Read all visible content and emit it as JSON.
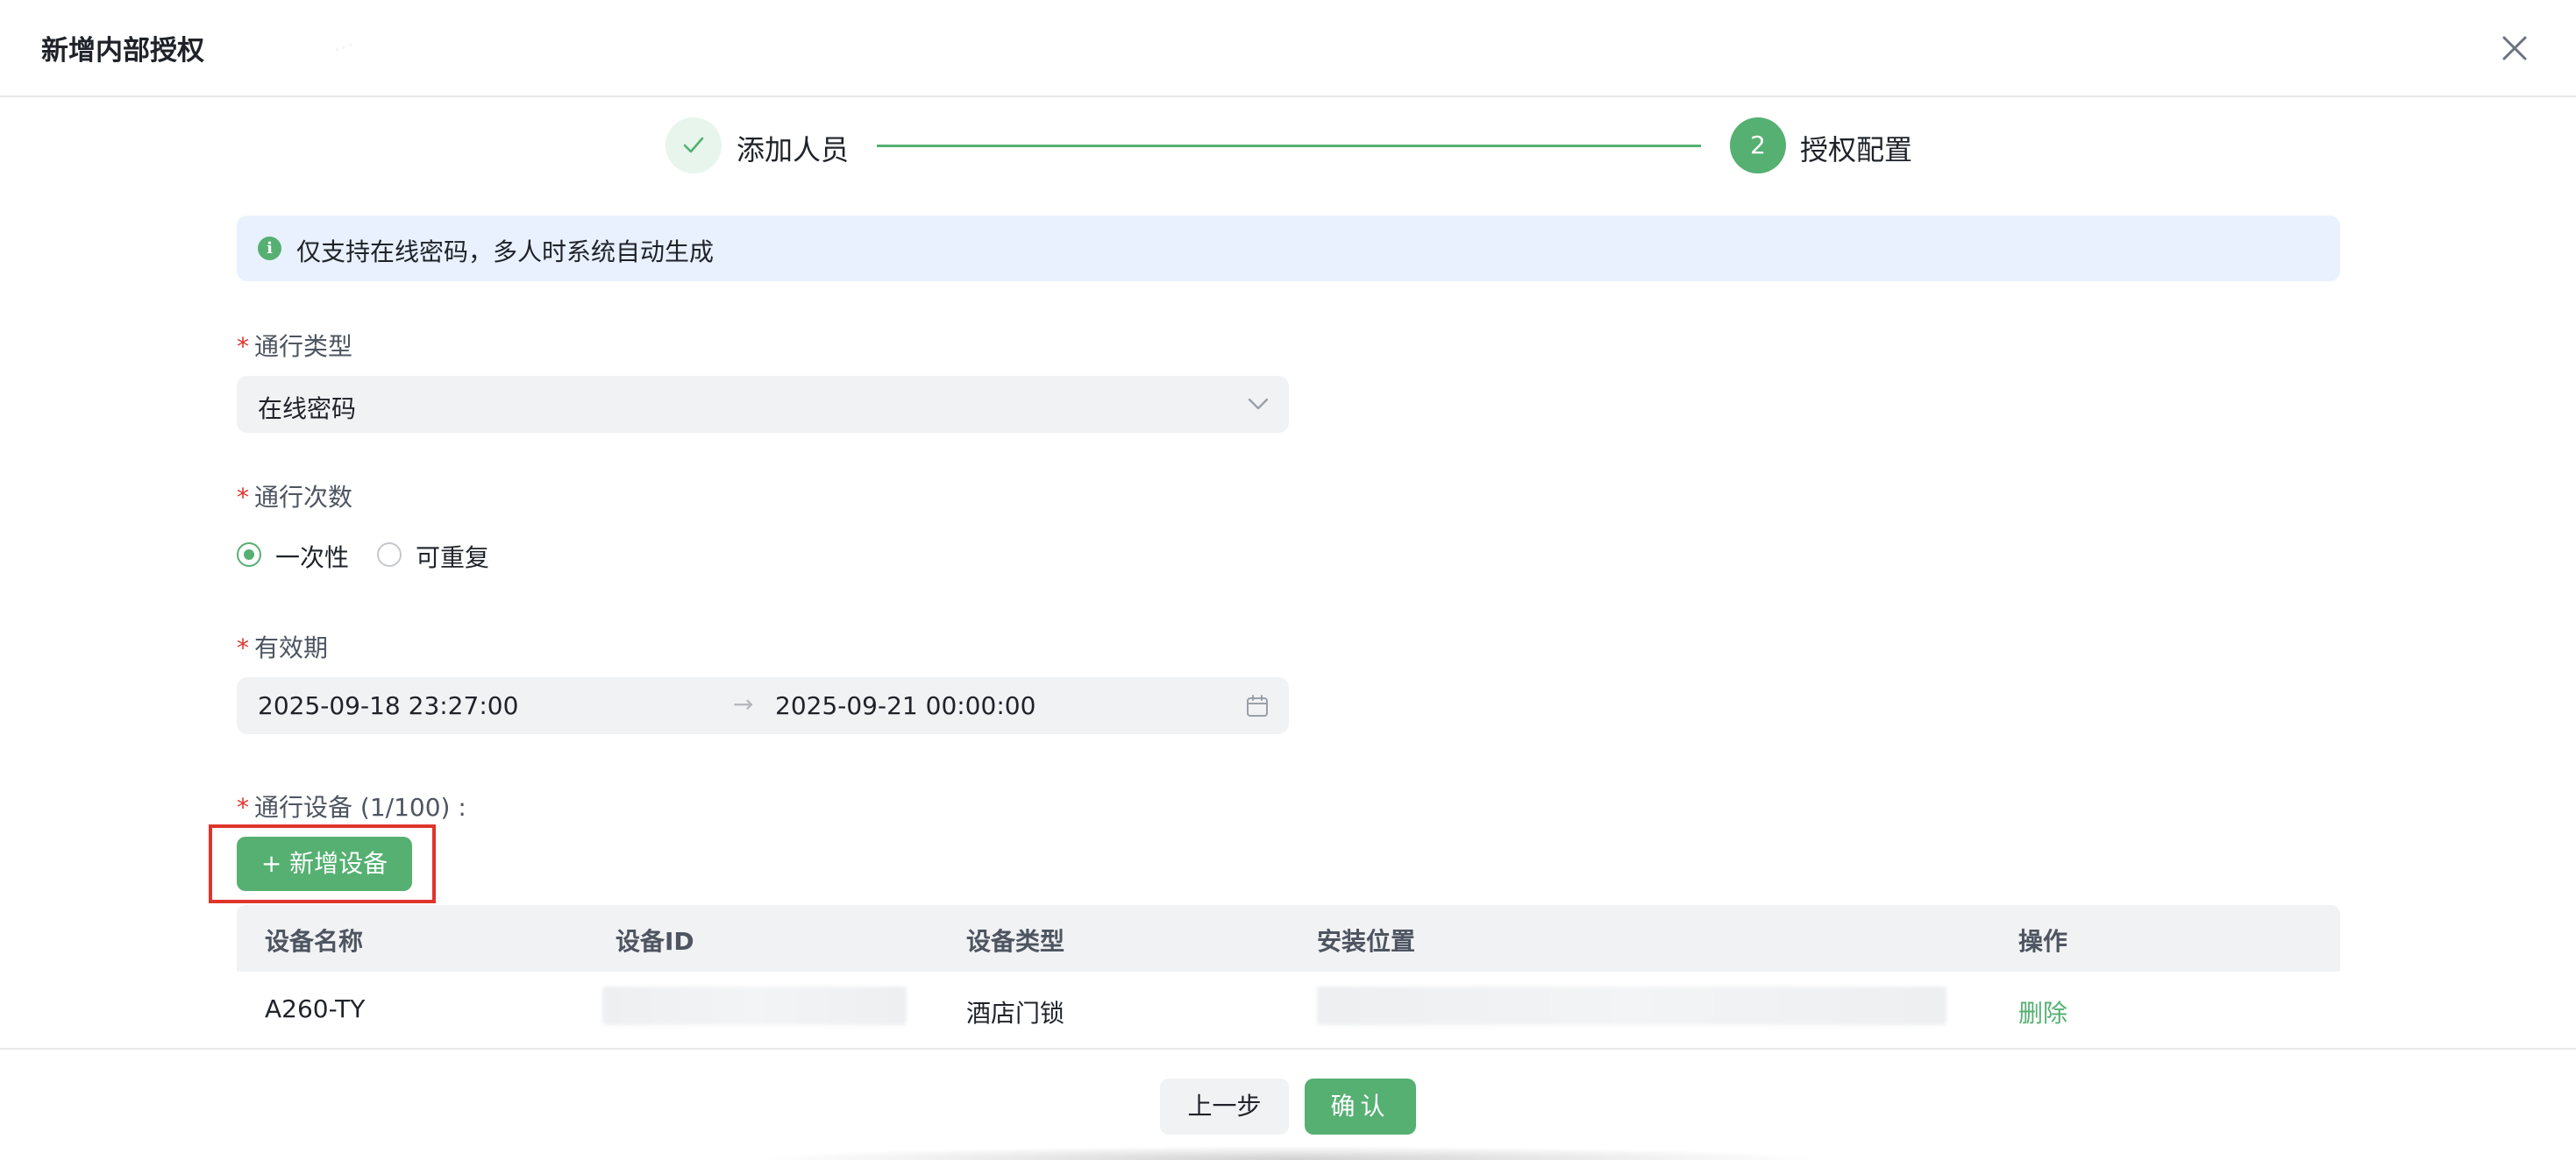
{
  "dialog": {
    "title": "新增内部授权"
  },
  "steps": [
    {
      "label": "添加人员",
      "status": "done"
    },
    {
      "number": "2",
      "label": "授权配置",
      "status": "active"
    }
  ],
  "alert": {
    "text": "仅支持在线密码，多人时系统自动生成"
  },
  "form": {
    "pass_type": {
      "label": "通行类型",
      "value": "在线密码"
    },
    "pass_count": {
      "label": "通行次数",
      "options": [
        "一次性",
        "可重复"
      ],
      "selected": "一次性"
    },
    "validity": {
      "label": "有效期",
      "start": "2025-09-18 23:27:00",
      "separator": "→",
      "end": "2025-09-21 00:00:00"
    },
    "devices": {
      "label": "通行设备 (1/100) :",
      "add_button": "+ 新增设备"
    }
  },
  "table": {
    "columns": [
      "设备名称",
      "设备ID",
      "设备类型",
      "安装位置",
      "操作"
    ],
    "rows": [
      {
        "name": "A260-TY",
        "id": "",
        "type": "酒店门锁",
        "location": "",
        "action": "删除"
      }
    ]
  },
  "footer": {
    "prev_label": "上一步",
    "confirm_label": "确认"
  },
  "colors": {
    "primary": "#55b072",
    "required": "#e0352b",
    "alert_bg": "#e8f1fd",
    "input_bg": "#f1f2f4"
  }
}
